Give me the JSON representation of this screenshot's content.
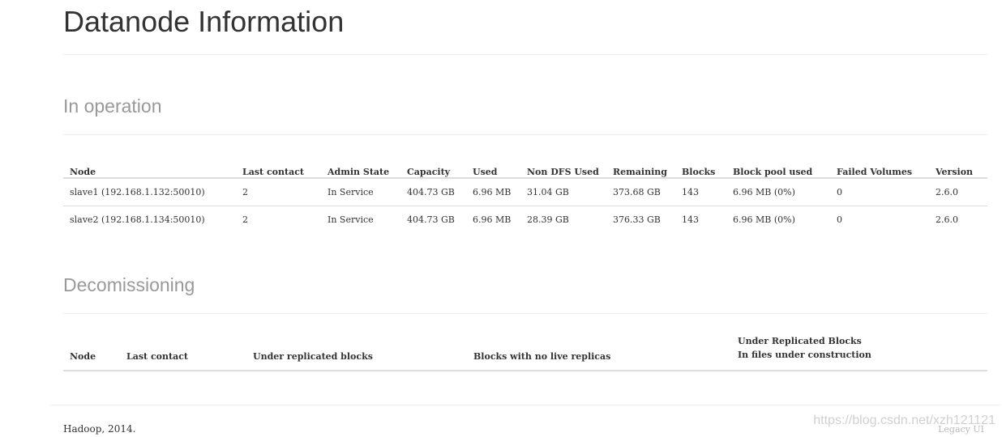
{
  "page": {
    "title": "Datanode Information"
  },
  "in_operation": {
    "title": "In operation",
    "columns": [
      "Node",
      "Last contact",
      "Admin State",
      "Capacity",
      "Used",
      "Non DFS Used",
      "Remaining",
      "Blocks",
      "Block pool used",
      "Failed Volumes",
      "Version"
    ],
    "rows": [
      [
        "slave1 (192.168.1.132:50010)",
        "2",
        "In Service",
        "404.73 GB",
        "6.96 MB",
        "31.04 GB",
        "373.68 GB",
        "143",
        "6.96 MB (0%)",
        "0",
        "2.6.0"
      ],
      [
        "slave2 (192.168.1.134:50010)",
        "2",
        "In Service",
        "404.73 GB",
        "6.96 MB",
        "28.39 GB",
        "376.33 GB",
        "143",
        "6.96 MB (0%)",
        "0",
        "2.6.0"
      ]
    ]
  },
  "decommissioning": {
    "title": "Decomissioning",
    "columns": [
      "Node",
      "Last contact",
      "Under replicated blocks",
      "Blocks with no live replicas"
    ],
    "last_column": {
      "line1": "Under Replicated Blocks",
      "line2": "In files under construction"
    }
  },
  "footer": {
    "text": "Hadoop, 2014.",
    "legacy_link": "Legacy UI"
  },
  "watermark": "https://blog.csdn.net/xzh121121"
}
